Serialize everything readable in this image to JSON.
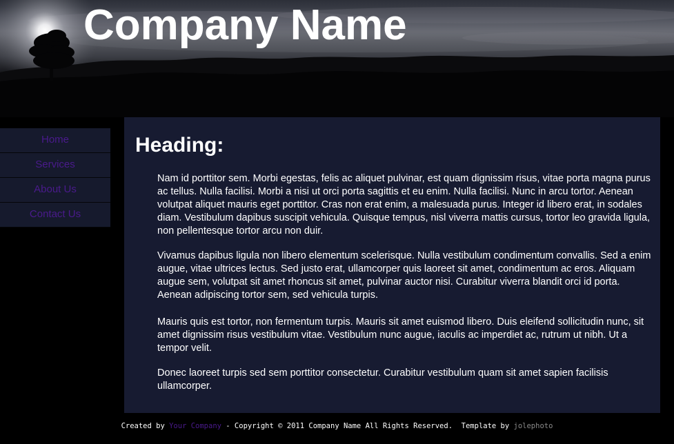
{
  "header": {
    "site_title": "Company Name"
  },
  "nav": {
    "items": [
      {
        "label": "Home"
      },
      {
        "label": "Services"
      },
      {
        "label": "About Us"
      },
      {
        "label": "Contact Us"
      }
    ]
  },
  "content": {
    "heading": "Heading:",
    "paragraphs": [
      "Nam id porttitor sem. Morbi egestas, felis ac aliquet pulvinar, est quam dignissim risus, vitae porta magna purus ac tellus. Nulla facilisi. Morbi a nisi ut orci porta sagittis et eu enim. Nulla facilisi. Nunc in arcu tortor. Aenean volutpat aliquet mauris eget porttitor. Cras non erat enim, a malesuada purus. Integer id libero erat, in sodales diam. Vestibulum dapibus suscipit vehicula. Quisque tempus, nisl viverra mattis cursus, tortor leo gravida ligula, non pellentesque tortor arcu non duir.",
      "Vivamus dapibus ligula non libero elementum scelerisque. Nulla vestibulum condimentum convallis. Sed a enim augue, vitae ultrices lectus. Sed justo erat, ullamcorper quis laoreet sit amet, condimentum ac eros. Aliquam augue sem, volutpat sit amet rhoncus sit amet, pulvinar auctor nisi. Curabitur viverra blandit orci id porta. Aenean adipiscing tortor sem, sed vehicula turpis.",
      "Mauris quis est tortor, non fermentum turpis. Mauris sit amet euismod libero. Duis eleifend sollicitudin nunc, sit amet dignissim risus vestibulum vitae. Vestibulum nunc augue, iaculis ac imperdiet ac, rutrum ut nibh. Ut a tempor velit.",
      "Donec laoreet turpis sed sem porttitor consectetur. Curabitur vestibulum quam sit amet sapien facilisis ullamcorper."
    ]
  },
  "footer": {
    "prefix": "Created by ",
    "company_link": "Your Company",
    "copyright": " - Copyright © 2011 Company Name All Rights Reserved.  Template by ",
    "author_link": "jolephoto"
  },
  "colors": {
    "page_background": "#000000",
    "panel_background": "#171b31",
    "nav_background": "#161a2d",
    "link_purple": "#4a1a8c",
    "text": "#ffffff",
    "muted_link": "#8a8a8a"
  }
}
